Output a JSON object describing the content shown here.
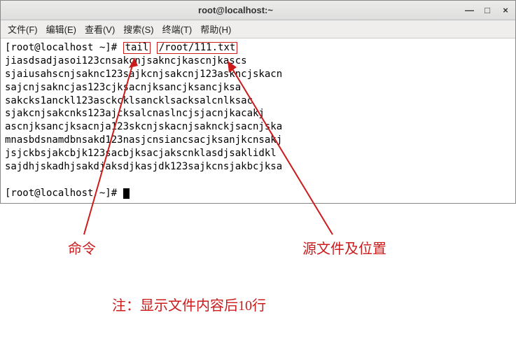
{
  "title": "root@localhost:~",
  "menu": {
    "file": "文件(F)",
    "edit": "编辑(E)",
    "view": "查看(V)",
    "search": "搜索(S)",
    "terminal": "终端(T)",
    "help": "帮助(H)"
  },
  "winctl": {
    "min": "—",
    "max": "□",
    "close": "×"
  },
  "term": {
    "prompt1_pre": "[root@localhost ~]# ",
    "cmd": "tail",
    "space": " ",
    "arg": "/root/111.txt",
    "out": [
      "jiasdsadjasoi123cnsakcnjsakncjkascnjkascs",
      "sjaiusahscnjsaknc123sajkcnjsakcnj123askncjskacn",
      "sajcnjsakncjas123cjksacnjksancjksancjksa",
      "sakcks1anckl123asckcklsancklsacksalcnlksac",
      "sjakcnjsakcnks123ajcksalcnaslncjsjacnjkacakj",
      "ascnjksancjksacnja123skcnjskacnjsaknckjsacnjska",
      "mnasbdsnamdbnsakd123nasjcnsiancsacjksanjkcnsakj",
      "jsjckbsjakcbjk123sacbjksacjakscnklasdjsaklidkl",
      "sajdhjskadhjsakdjaksdjkasjdk123sajkcnsjakbcjksa"
    ],
    "prompt2": "[root@localhost ~]# "
  },
  "labels": {
    "cmd": "命令",
    "src": "源文件及位置",
    "note": "注：显示文件内容后10行"
  }
}
